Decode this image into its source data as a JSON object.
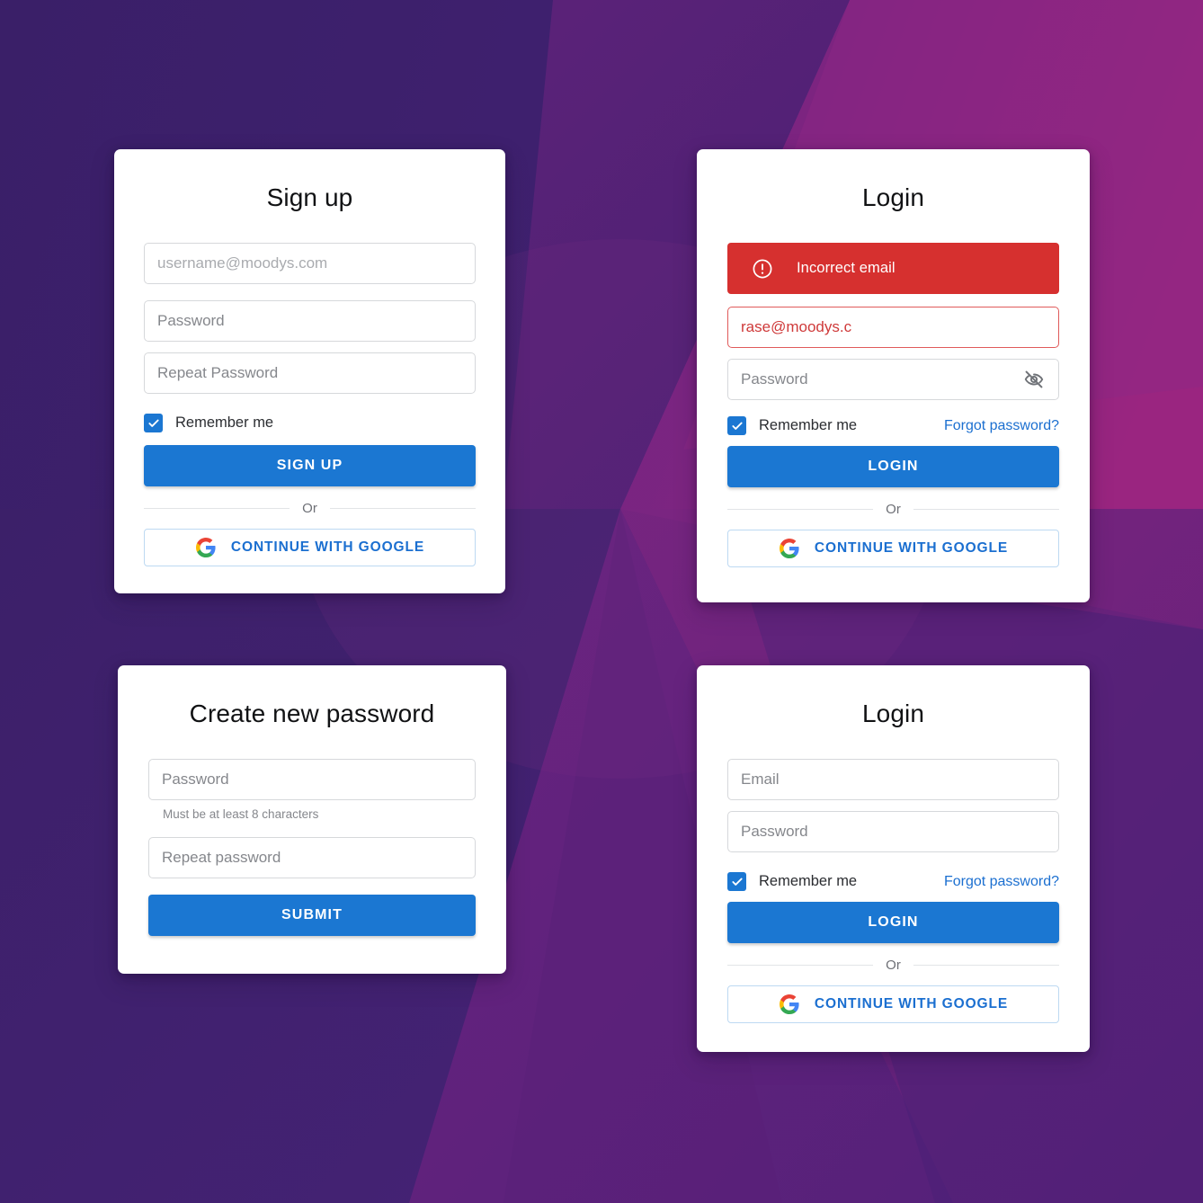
{
  "theme": {
    "accent_blue": "#1b77d2",
    "link_blue": "#1b6fd0",
    "error_red": "#d6302f",
    "error_border": "#e05a5a",
    "bg_left": "#3a1f68",
    "bg_right": "#97257f",
    "card_bg": "#ffffff",
    "placeholder_gray": "#85878c"
  },
  "shared": {
    "or_label": "Or",
    "google_button_label": "CONTINUE WITH GOOGLE",
    "google_icon": "google-g-icon",
    "remember_me_label": "Remember me",
    "forgot_password_label": "Forgot password?",
    "check_icon": "checkmark-icon"
  },
  "cards": {
    "signup": {
      "title": "Sign up",
      "fields": [
        {
          "name": "email",
          "placeholder": "username@moodys.com",
          "faint": true
        },
        {
          "name": "password",
          "placeholder": "Password",
          "faint": false
        },
        {
          "name": "repeat-password",
          "placeholder": "Repeat Password",
          "faint": false
        }
      ],
      "remember_me_label": "Remember me",
      "remember_me_checked": true,
      "submit_label": "SIGN UP",
      "or_label": "Or",
      "google_button_label": "CONTINUE WITH GOOGLE"
    },
    "login_error": {
      "title": "Login",
      "alert": {
        "icon": "error-circle-icon",
        "message": "Incorrect email"
      },
      "email_value": "rase@moodys.c",
      "email_has_error": true,
      "password_placeholder": "Password",
      "password_toggle_icon": "eye-off-icon",
      "remember_me_label": "Remember me",
      "remember_me_checked": true,
      "forgot_password_label": "Forgot password?",
      "submit_label": "LOGIN",
      "or_label": "Or",
      "google_button_label": "CONTINUE WITH GOOGLE"
    },
    "new_password": {
      "title": "Create new password",
      "password_placeholder": "Password",
      "helper_text": "Must be at least 8 characters",
      "repeat_placeholder": "Repeat password",
      "submit_label": "SUBMIT"
    },
    "login": {
      "title": "Login",
      "email_placeholder": "Email",
      "password_placeholder": "Password",
      "remember_me_label": "Remember me",
      "remember_me_checked": true,
      "forgot_password_label": "Forgot password?",
      "submit_label": "LOGIN",
      "or_label": "Or",
      "google_button_label": "CONTINUE WITH GOOGLE"
    }
  }
}
